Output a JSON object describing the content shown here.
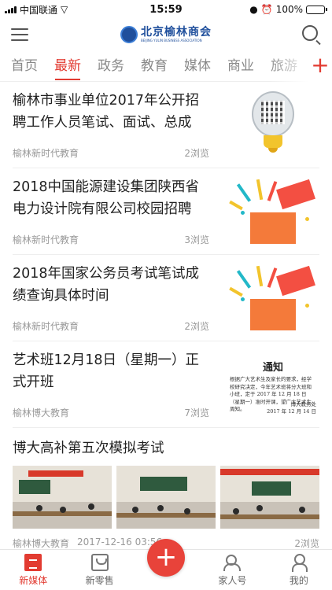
{
  "status_bar": {
    "carrier": "中国联通",
    "time": "15:59",
    "battery": "100%"
  },
  "header": {
    "logo_cn": "北京榆林商会",
    "logo_en": "BEIJING YULIN BUSINESS ASSOCIATION"
  },
  "tabs": [
    {
      "label": "首页"
    },
    {
      "label": "最新"
    },
    {
      "label": "政务"
    },
    {
      "label": "教育"
    },
    {
      "label": "媒体"
    },
    {
      "label": "商业"
    },
    {
      "label": "旅游"
    }
  ],
  "tab_add": "+",
  "articles": [
    {
      "title": "榆林市事业单位2017年公开招聘工作人员笔试、面试、总成",
      "source": "榆林新时代教育",
      "views": "2浏览"
    },
    {
      "title": "2018中国能源建设集团陕西省电力设计院有限公司校园招聘",
      "source": "榆林新时代教育",
      "views": "3浏览"
    },
    {
      "title": "2018年国家公务员考试笔试成绩查询具体时间",
      "source": "榆林新时代教育",
      "views": "2浏览"
    },
    {
      "title": "艺术班12月18日（星期一）正式开班",
      "source": "榆林博大教育",
      "views": "7浏览"
    }
  ],
  "notice_thumb": {
    "title": "通知",
    "body": "根据广大艺术生及家长的要求，经学校研究决定，今年艺术班将分大班和小班，定于 2017 年 12 月 18 日（星期一）准时开课，望广大艺术生周知。",
    "sign_org": "博大教务处",
    "sign_date": "2017 年 12 月 14 日"
  },
  "wide_article": {
    "title": "博大高补第五次模拟考试",
    "source": "榆林博大教育",
    "date": "2017-12-16 03:56",
    "views": "2浏览"
  },
  "tabbar": {
    "items": [
      {
        "label": "新媒体"
      },
      {
        "label": "新零售"
      },
      {
        "label": "+"
      },
      {
        "label": "家人号"
      },
      {
        "label": "我的"
      }
    ]
  },
  "colors": {
    "accent": "#e23b31",
    "battery": "#35c759",
    "brand_blue": "#1f4f9c"
  }
}
